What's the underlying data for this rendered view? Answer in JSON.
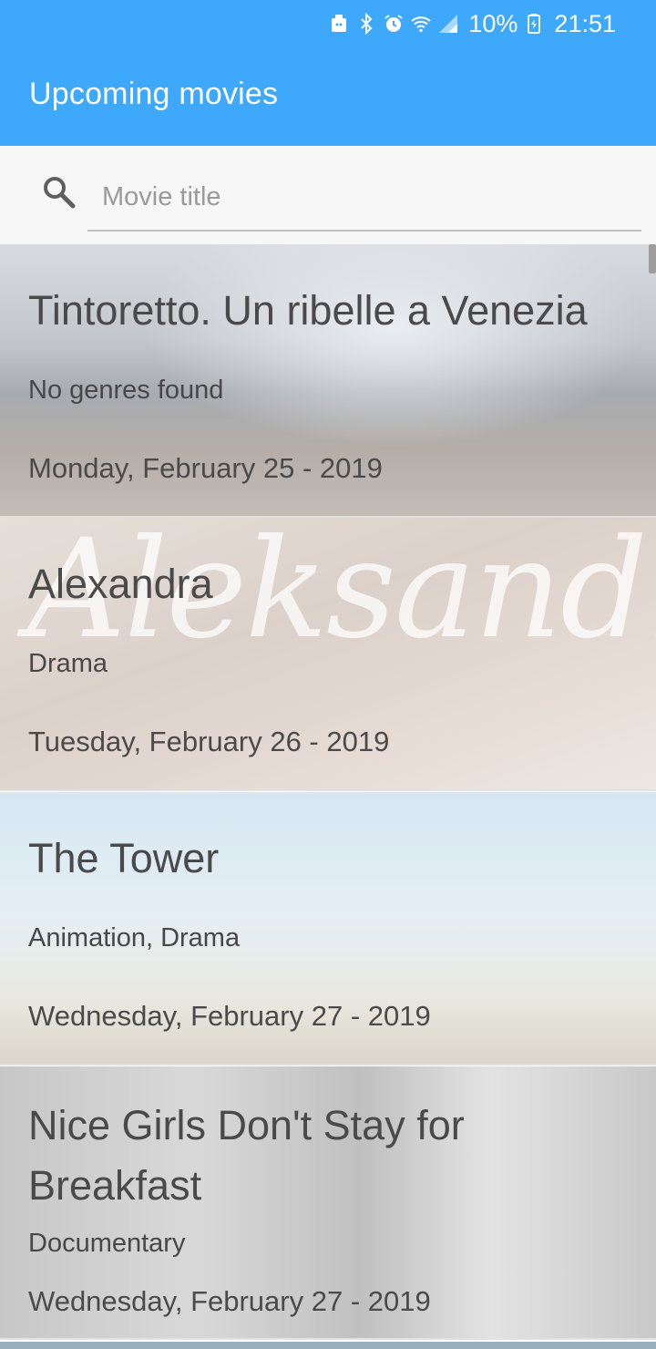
{
  "status_bar": {
    "battery_percent": "10%",
    "time": "21:51",
    "icons": [
      "android-icon",
      "bluetooth-icon",
      "alarm-icon",
      "wifi-icon",
      "signal-icon",
      "battery-charging-icon"
    ]
  },
  "toolbar": {
    "title": "Upcoming movies",
    "background_color": "#3ea9fb"
  },
  "search": {
    "placeholder": "Movie title",
    "value": ""
  },
  "movies": [
    {
      "title": "Tintoretto. Un ribelle a Venezia",
      "genres": "No genres found",
      "date": "Monday, February 25 - 2019"
    },
    {
      "title": "Alexandra",
      "genres": "Drama",
      "date": "Tuesday, February 26 - 2019",
      "poster_text": "Aleksandra"
    },
    {
      "title": "The Tower",
      "genres": "Animation, Drama",
      "date": "Wednesday, February 27 - 2019"
    },
    {
      "title": "Nice Girls Don't Stay for Breakfast",
      "genres": "Documentary",
      "date": "Wednesday, February 27 - 2019"
    }
  ]
}
